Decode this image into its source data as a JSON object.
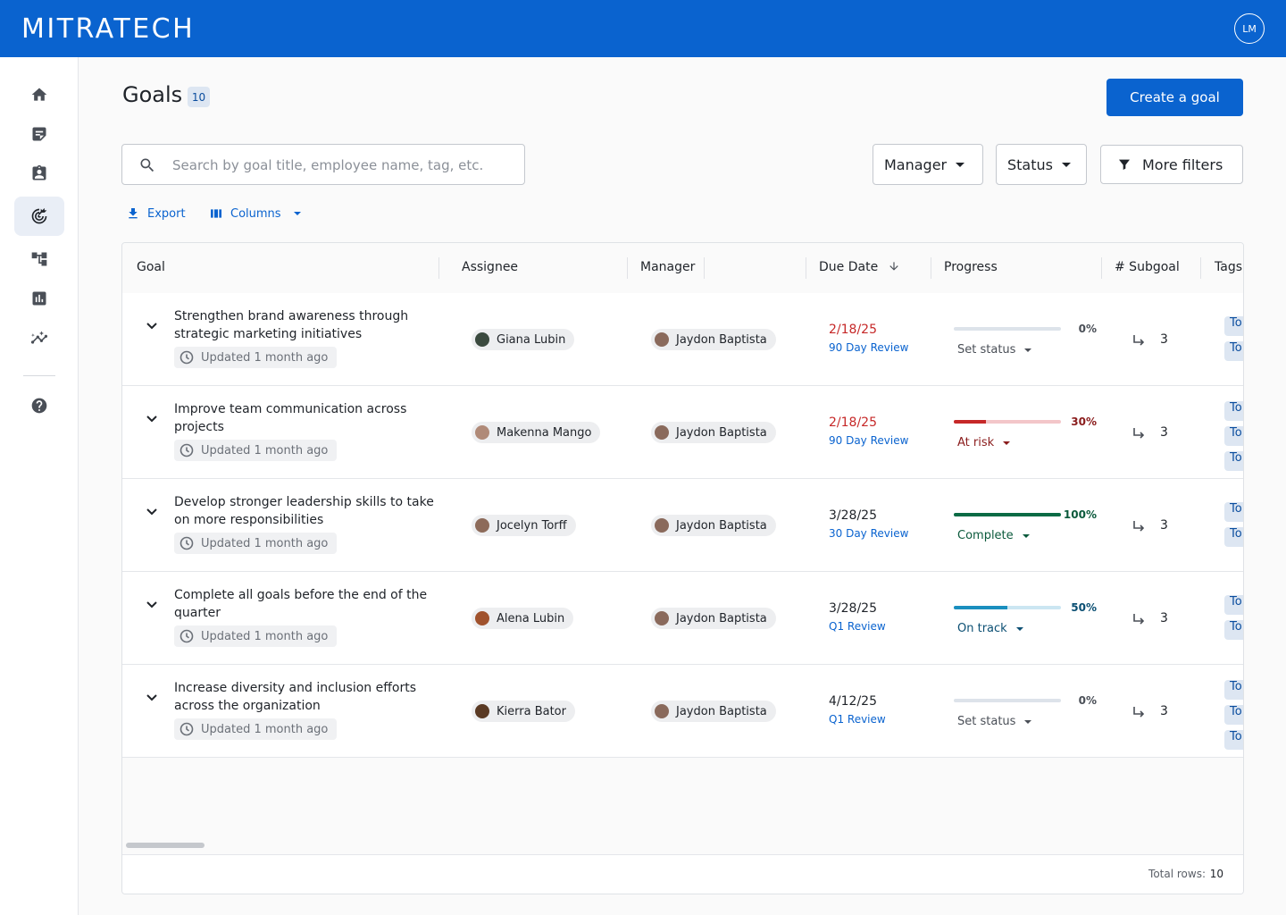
{
  "app": {
    "logo_text": "MITRATECH",
    "user_initials": "LM"
  },
  "sidebar": {
    "items": [
      {
        "name": "home-icon",
        "active": false
      },
      {
        "name": "notes-icon",
        "active": false
      },
      {
        "name": "badge-icon",
        "active": false
      },
      {
        "name": "goals-icon",
        "active": true
      },
      {
        "name": "org-chart-icon",
        "active": false
      },
      {
        "name": "report-icon",
        "active": false
      },
      {
        "name": "analytics-icon",
        "active": false
      },
      {
        "name": "help-icon",
        "active": false
      }
    ]
  },
  "page": {
    "title": "Goals",
    "count": "10",
    "create_button": "Create a goal"
  },
  "search": {
    "placeholder": "Search by goal title, employee name, tag, etc.",
    "value": ""
  },
  "filters": {
    "manager": "Manager",
    "status": "Status",
    "more": "More filters"
  },
  "toolbar": {
    "export": "Export",
    "columns": "Columns"
  },
  "columns": [
    "Goal",
    "Assignee",
    "Manager",
    "Due Date",
    "Progress",
    "# Subgoal",
    "Tags"
  ],
  "rows": [
    {
      "title": "Strengthen brand awareness through strategic marketing initiatives",
      "updated": "Updated 1 month ago",
      "assignee": "Giana Lubin",
      "manager": "Jaydon Baptista",
      "due_date": "2/18/25",
      "due_overdue": true,
      "review": "90 Day Review",
      "progress": 0,
      "progress_label": "0%",
      "status": "Set status",
      "subgoals": "3",
      "tags": [
        "To",
        "To"
      ]
    },
    {
      "title": "Improve team communication across projects",
      "updated": "Updated 1 month ago",
      "assignee": "Makenna Mango",
      "manager": "Jaydon Baptista",
      "due_date": "2/18/25",
      "due_overdue": true,
      "review": "90 Day Review",
      "progress": 30,
      "progress_label": "30%",
      "status": "At risk",
      "subgoals": "3",
      "tags": [
        "To",
        "To",
        "To"
      ]
    },
    {
      "title": "Develop stronger leadership skills to take on more responsibilities",
      "updated": "Updated 1 month ago",
      "assignee": "Jocelyn Torff",
      "manager": "Jaydon Baptista",
      "due_date": "3/28/25",
      "due_overdue": false,
      "review": "30 Day Review",
      "progress": 100,
      "progress_label": "100%",
      "status": "Complete",
      "subgoals": "3",
      "tags": [
        "To",
        "To"
      ]
    },
    {
      "title": "Complete all goals before the end of the quarter",
      "updated": "Updated 1 month ago",
      "assignee": "Alena Lubin",
      "manager": "Jaydon Baptista",
      "due_date": "3/28/25",
      "due_overdue": false,
      "review": "Q1 Review",
      "progress": 50,
      "progress_label": "50%",
      "status": "On track",
      "subgoals": "3",
      "tags": [
        "To",
        "To"
      ]
    },
    {
      "title": "Increase diversity and inclusion efforts across the organization",
      "updated": "Updated 1 month ago",
      "assignee": "Kierra Bator",
      "manager": "Jaydon Baptista",
      "due_date": "4/12/25",
      "due_overdue": false,
      "review": "Q1 Review",
      "progress": 0,
      "progress_label": "0%",
      "status": "Set status",
      "subgoals": "3",
      "tags": [
        "To",
        "To",
        "To"
      ]
    }
  ],
  "footer": {
    "total_label": "Total rows:",
    "total_value": "10"
  },
  "colors": {
    "brand": "#0a63cf",
    "overdue": "#c62828",
    "at_risk": "#c62828",
    "at_risk_track": "#f3c6c9",
    "complete": "#0b6b45",
    "on_track": "#1a8fbf",
    "on_track_track": "#cbe6f2",
    "neutral_track": "#dde3ea",
    "at_risk_text": "#8a1c1c",
    "complete_text": "#0b5a3c",
    "on_track_text": "#0b4f73",
    "neutral_text": "#4a4f57"
  }
}
